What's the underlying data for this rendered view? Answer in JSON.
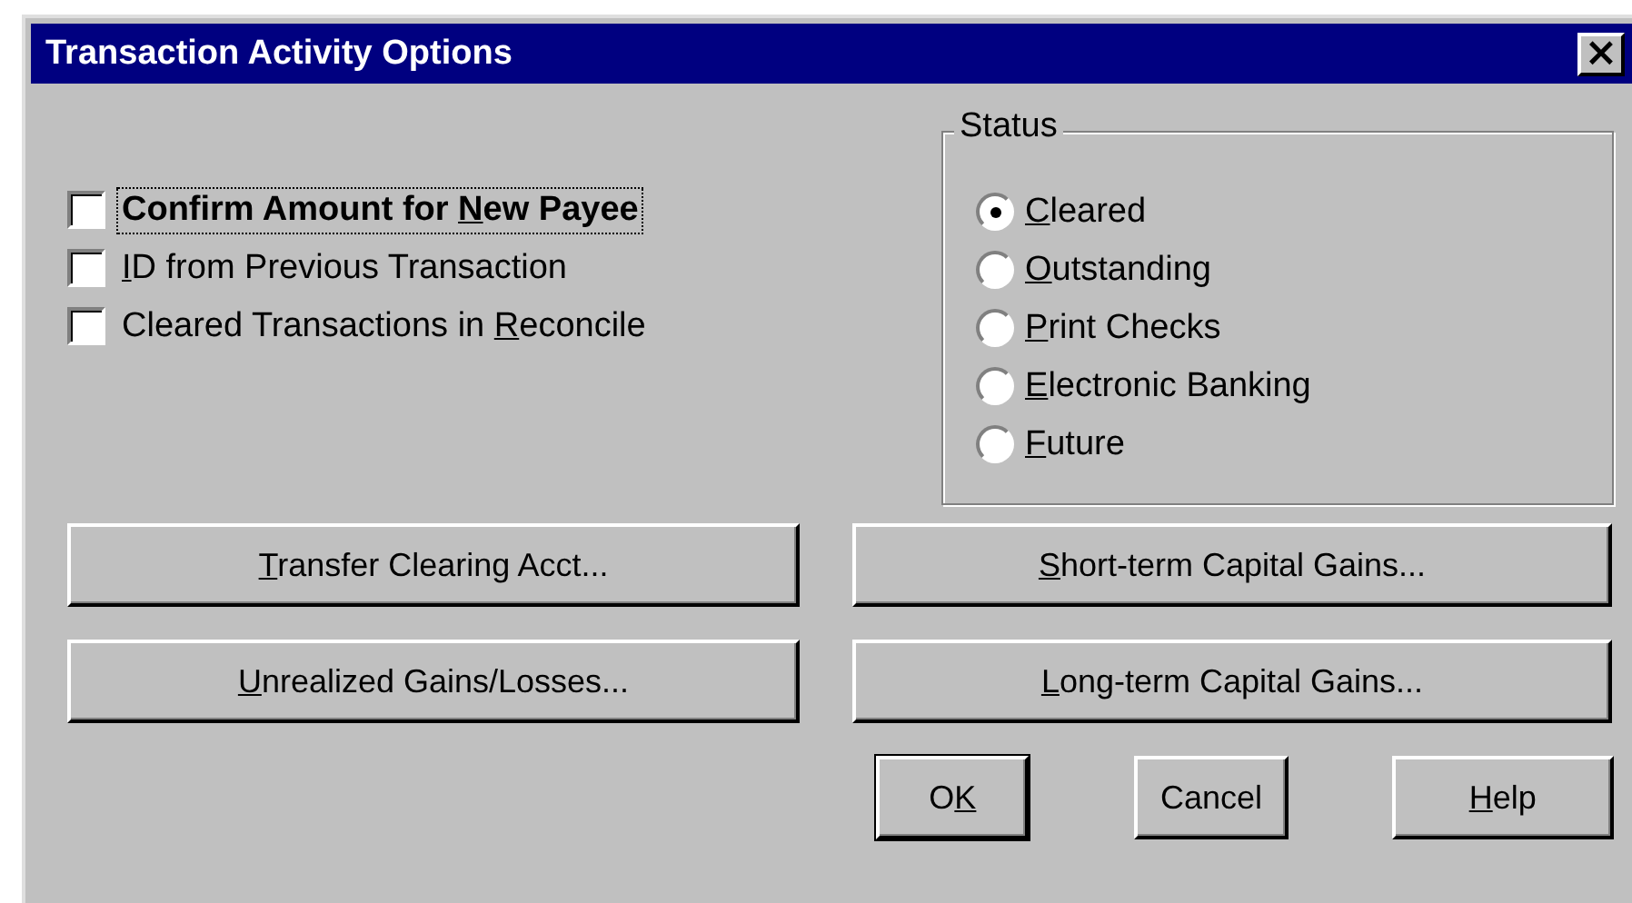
{
  "window": {
    "title": "Transaction Activity Options",
    "close": "×"
  },
  "checkboxes": [
    {
      "pre": "Confirm Amount for ",
      "key": "N",
      "post": "ew Payee",
      "checked": false,
      "focused": true
    },
    {
      "key": "I",
      "post": "D from Previous Transaction",
      "checked": false,
      "focused": false
    },
    {
      "pre": "Cleared Transactions in ",
      "key": "R",
      "post": "econcile",
      "checked": false,
      "focused": false
    }
  ],
  "status": {
    "title": "Status",
    "options": [
      {
        "key": "C",
        "post": "leared",
        "selected": true
      },
      {
        "key": "O",
        "post": "utstanding",
        "selected": false
      },
      {
        "key": "P",
        "post": "rint Checks",
        "selected": false
      },
      {
        "key": "E",
        "post": "lectronic Banking",
        "selected": false
      },
      {
        "key": "F",
        "post": "uture",
        "selected": false
      }
    ]
  },
  "buttons": [
    {
      "key": "T",
      "post": "ransfer Clearing Acct..."
    },
    {
      "key": "S",
      "post": "hort-term Capital Gains..."
    },
    {
      "key": "U",
      "post": "nrealized Gains/Losses..."
    },
    {
      "key": "L",
      "post": "ong-term Capital Gains..."
    }
  ],
  "actions": [
    {
      "pre": "O",
      "key": "K",
      "default": true
    },
    {
      "pre": "Cancel",
      "default": false
    },
    {
      "key": "H",
      "post": "elp",
      "default": false
    }
  ]
}
